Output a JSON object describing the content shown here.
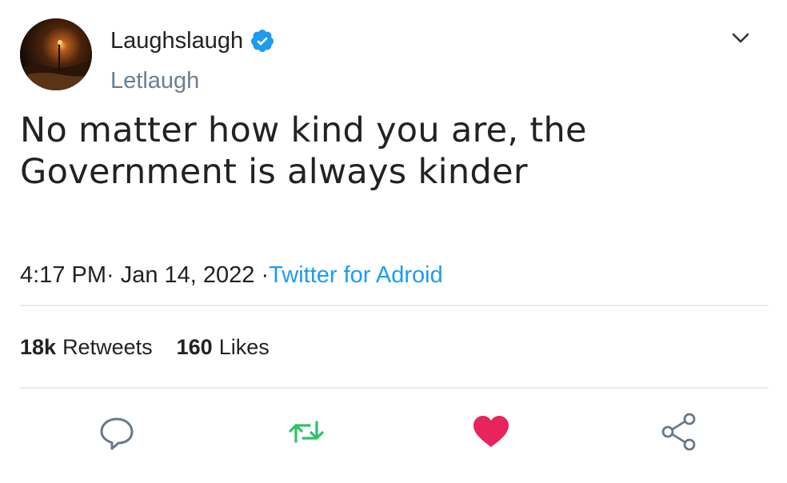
{
  "tweet": {
    "author": {
      "display_name": "Laughslaugh",
      "handle": "Letlaugh",
      "verified": true
    },
    "text": "No matter how kind you are, the Government is always kinder",
    "time": "4:17 PM",
    "time_sep": "· ",
    "date": "Jan 14, 2022",
    "source_sep": " ·",
    "source": "Twitter for Adroid",
    "stats": {
      "retweets_count": "18k",
      "retweets_label": "Retweets",
      "likes_count": "160",
      "likes_label": "Likes"
    }
  },
  "icons": {
    "verified": "verified-badge-icon",
    "more": "chevron-down-icon",
    "reply": "reply-icon",
    "retweet": "retweet-icon",
    "like": "heart-icon",
    "share": "share-icon"
  },
  "colors": {
    "accent": "#1d9bf0",
    "handle": "#6a7f91",
    "retweet": "#2cc16a",
    "like": "#e8245c",
    "icon_gray": "#69788a",
    "divider": "#e8ecef",
    "text": "#222222"
  }
}
